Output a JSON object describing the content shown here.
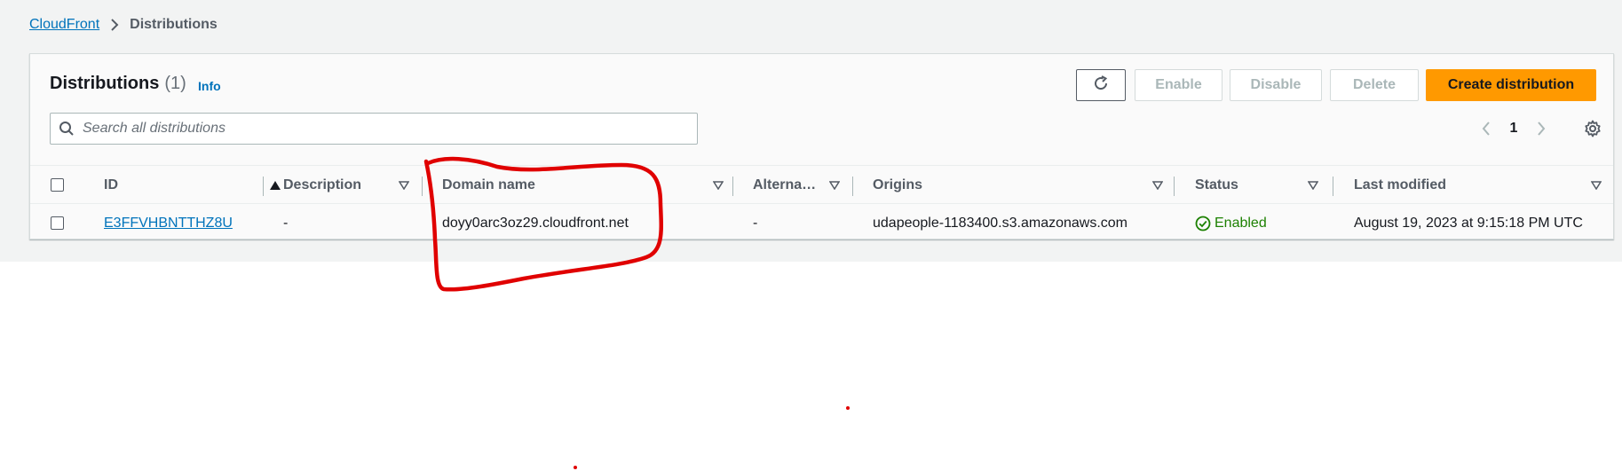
{
  "breadcrumb": {
    "root": "CloudFront",
    "current": "Distributions"
  },
  "header": {
    "title": "Distributions",
    "count": "(1)",
    "info": "Info"
  },
  "actions": {
    "refresh_icon": "refresh-icon",
    "enable": "Enable",
    "disable": "Disable",
    "delete": "Delete",
    "create": "Create distribution"
  },
  "search": {
    "placeholder": "Search all distributions",
    "value": ""
  },
  "pagination": {
    "current_page": "1"
  },
  "table": {
    "columns": {
      "id": "ID",
      "description": "Description",
      "domain": "Domain name",
      "alternate": "Alterna…",
      "origins": "Origins",
      "status": "Status",
      "modified": "Last modified"
    },
    "rows": [
      {
        "id": "E3FFVHBNTTHZ8U",
        "description": "-",
        "domain": "doyy0arc3oz29.cloudfront.net",
        "alternate": "-",
        "origins": "udapeople-1183400.s3.amazonaws.com",
        "status": "Enabled",
        "modified": "August 19, 2023 at 9:15:18 PM UTC"
      }
    ]
  },
  "colors": {
    "accent": "#ff9900",
    "link": "#0073bb",
    "success": "#1d8102",
    "annotation": "#e00000"
  }
}
